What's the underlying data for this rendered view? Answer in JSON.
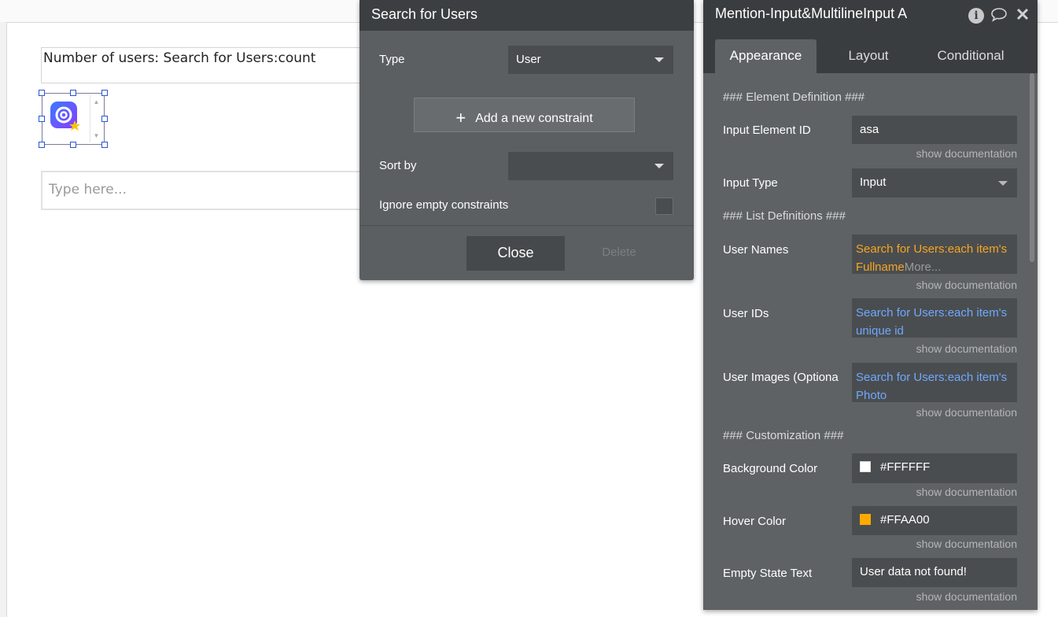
{
  "canvas": {
    "text_element": "Number of users: Search for Users:count",
    "input_placeholder": "Type here..."
  },
  "search_popup": {
    "title": "Search for Users",
    "type_label": "Type",
    "type_value": "User",
    "add_constraint_label": "Add a new constraint",
    "sort_by_label": "Sort by",
    "sort_by_value": "",
    "ignore_empty_label": "Ignore empty constraints",
    "close_label": "Close",
    "delete_label": "Delete"
  },
  "property_editor": {
    "title": "Mention-Input&MultilineInput A",
    "tabs": [
      "Appearance",
      "Layout",
      "Conditional"
    ],
    "active_tab": "Appearance",
    "section_element_def": "### Element Definition ###",
    "input_element_id_label": "Input Element ID",
    "input_element_id_value": "asa",
    "input_type_label": "Input Type",
    "input_type_value": "Input",
    "section_list_defs": "### List Definitions ###",
    "user_names_label": "User Names",
    "user_names_value": "Search for Users:each item's Fullname",
    "user_names_more": "More...",
    "user_ids_label": "User IDs",
    "user_ids_value": "Search for Users:each item's unique id",
    "user_images_label": "User Images (Optiona",
    "user_images_value": "Search for Users:each item's Photo",
    "section_customization": "### Customization ###",
    "bg_color_label": "Background Color",
    "bg_color_value": "#FFFFFF",
    "hover_color_label": "Hover Color",
    "hover_color_value": "#FFAA00",
    "empty_state_label": "Empty State Text",
    "empty_state_value": "User data not found!",
    "show_doc": "show documentation"
  },
  "colors": {
    "accent_orange": "#f5a623",
    "accent_blue": "#6fa8ff",
    "swatch_white": "#FFFFFF",
    "swatch_orange": "#FFAA00"
  },
  "icons": [
    "info-icon",
    "comment-icon",
    "close-icon",
    "plus-icon",
    "caret-down-icon",
    "mention-logo-icon"
  ]
}
